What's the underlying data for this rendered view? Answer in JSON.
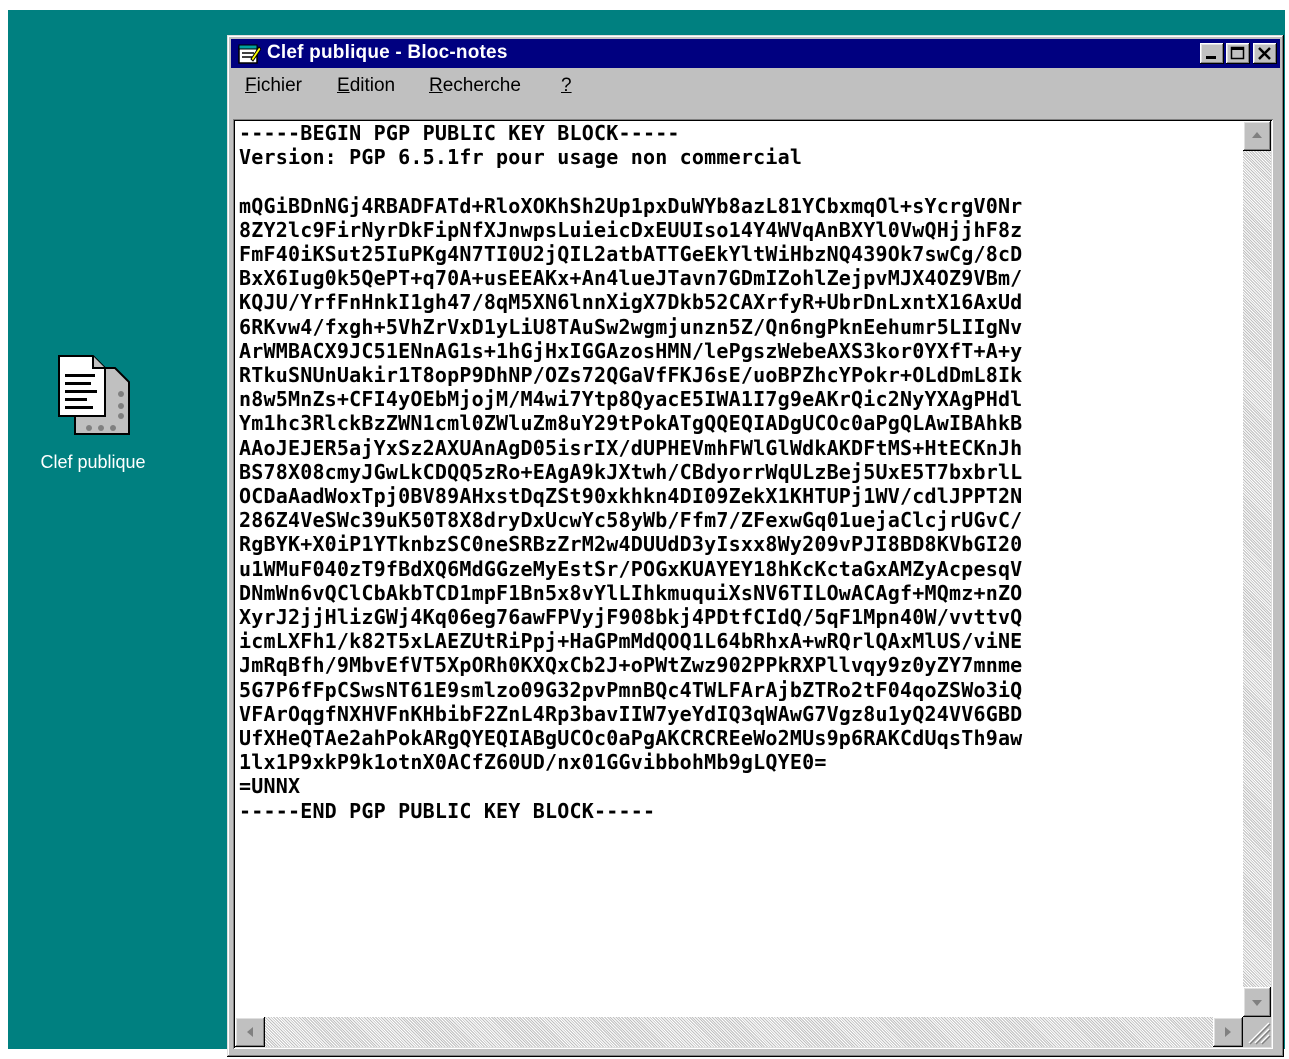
{
  "desktop": {
    "background": "#008080",
    "icon": {
      "label": "Clef publique",
      "icon": "text-file-icon"
    }
  },
  "window": {
    "title": "Clef publique - Bloc-notes",
    "title_icon": "notepad-icon",
    "controls": {
      "minimize": "minimize-icon",
      "maximize": "maximize-icon",
      "close": "close-icon"
    }
  },
  "menu": {
    "items": [
      {
        "accel": "F",
        "rest": "ichier"
      },
      {
        "accel": "E",
        "rest": "dition"
      },
      {
        "accel": "R",
        "rest": "echerche"
      },
      {
        "accel": "?",
        "rest": ""
      }
    ]
  },
  "document": {
    "content": "-----BEGIN PGP PUBLIC KEY BLOCK-----\nVersion: PGP 6.5.1fr pour usage non commercial\n\nmQGiBDnNGj4RBADFATd+RloXOKhSh2Up1pxDuWYb8azL81YCbxmqOl+sYcrgV0Nr\n8ZY2lc9FirNyrDkFipNfXJnwpsLuieicDxEUUIso14Y4WVqAnBXYl0VwQHjjhF8z\nFmF40iKSut25IuPKg4N7TI0U2jQIL2atbATTGeEkYltWiHbzNQ439Ok7swCg/8cD\nBxX6Iug0k5QePT+q70A+usEEAKx+An4lueJTavn7GDmIZohlZejpvMJX4OZ9VBm/\nKQJU/YrfFnHnkI1gh47/8qM5XN6lnnXigX7Dkb52CAXrfyR+UbrDnLxntX16AxUd\n6RKvw4/fxgh+5VhZrVxD1yLiU8TAuSw2wgmjunzn5Z/Qn6ngPknEehumr5LIIgNv\nArWMBACX9JC51ENnAG1s+1hGjHxIGGAzosHMN/lePgszWebeAXS3kor0YXfT+A+y\nRTkuSNUnUakir1T8opP9DhNP/OZs72QGaVfFKJ6sE/uoBPZhcYPokr+OLdDmL8Ik\nn8w5MnZs+CFI4yOEbMjojM/M4wi7Ytp8QyacE5IWA1I7g9eAKrQic2NyYXAgPHdl\nYm1hc3RlckBzZWN1cml0ZWluZm8uY29tPokATgQQEQIADgUCOc0aPgQLAwIBAhkB\nAAoJEJER5ajYxSz2AXUAnAgD05isrIX/dUPHEVmhFWlGlWdkAKDFtMS+HtECKnJh\nBS78X08cmyJGwLkCDQQ5zRo+EAgA9kJXtwh/CBdyorrWqULzBej5UxE5T7bxbrlL\nOCDaAadWoxTpj0BV89AHxstDqZSt90xkhkn4DI09ZekX1KHTUPj1WV/cdlJPPT2N\n286Z4VeSWc39uK50T8X8dryDxUcwYc58yWb/Ffm7/ZFexwGq01uejaClcjrUGvC/\nRgBYK+X0iP1YTknbzSC0neSRBzZrM2w4DUUdD3yIsxx8Wy209vPJI8BD8KVbGI20\nu1WMuF040zT9fBdXQ6MdGGzeMyEstSr/POGxKUAYEY18hKcKctaGxAMZyAcpesqV\nDNmWn6vQClCbAkbTCD1mpF1Bn5x8vYlLIhkmuquiXsNV6TILOwACAgf+MQmz+nZO\nXyrJ2jjHlizGWj4Kq06eg76awFPVyjF908bkj4PDtfCIdQ/5qF1Mpn40W/vvttvQ\nicmLXFh1/k82T5xLAEZUtRiPpj+HaGPmMdQOQ1L64bRhxA+wRQrlQAxMlUS/viNE\nJmRqBfh/9MbvEfVT5XpORh0KXQxCb2J+oPWtZwz902PPkRXPllvqy9z0yZY7mnme\n5G7P6fFpCSwsNT61E9smlzo09G32pvPmnBQc4TWLFArAjbZTRo2tF04qoZSWo3iQ\nVFArOqgfNXHVFnKHbibF2ZnL4Rp3bavIIW7yeYdIQ3qWAwG7Vgz8u1yQ24VV6GBD\nUfXHeQTAe2ahPokARgQYEQIABgUCOc0aPgAKCRCREeWo2MUs9p6RAKCdUqsTh9aw\n1lx1P9xkP9k1otnX0ACfZ60UD/nx01GGvibbohMb9gLQYE0=\n=UNNX\n-----END PGP PUBLIC KEY BLOCK-----"
  },
  "scrollbar": {
    "up": "scroll-up-arrow-icon",
    "down": "scroll-down-arrow-icon",
    "left": "scroll-left-arrow-icon",
    "right": "scroll-right-arrow-icon",
    "grip": "size-grip-icon"
  }
}
